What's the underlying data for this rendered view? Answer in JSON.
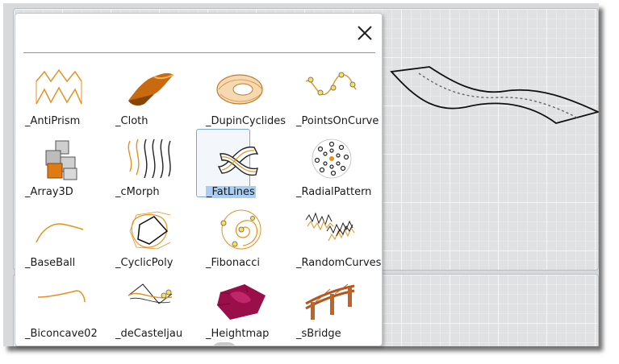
{
  "dialog": {
    "close_label": "×",
    "close_icon": "close-icon"
  },
  "items": [
    {
      "label": "_AntiPrism",
      "icon": "antiprism-icon"
    },
    {
      "label": "_Cloth",
      "icon": "cloth-icon"
    },
    {
      "label": "_DupinCyclides",
      "icon": "dupin-cyclide-icon"
    },
    {
      "label": "_PointsOnCurve",
      "icon": "points-on-curve-icon"
    },
    {
      "label": "_Array3D",
      "icon": "array3d-icon"
    },
    {
      "label": "_cMorph",
      "icon": "cmorph-icon"
    },
    {
      "label": "_FatLines",
      "icon": "fatlines-icon",
      "selected": true
    },
    {
      "label": "_RadialPattern",
      "icon": "radial-pattern-icon"
    },
    {
      "label": "_BaseBall",
      "icon": "baseball-icon"
    },
    {
      "label": "_CyclicPoly",
      "icon": "cyclic-poly-icon"
    },
    {
      "label": "_Fibonacci",
      "icon": "fibonacci-icon"
    },
    {
      "label": "_RandomCurves",
      "icon": "random-curves-icon"
    },
    {
      "label": "_Biconcave02",
      "icon": "biconcave-icon"
    },
    {
      "label": "_deCasteljau",
      "icon": "decasteljau-icon"
    },
    {
      "label": "_Heightmap",
      "icon": "heightmap-icon"
    },
    {
      "label": "_sBridge",
      "icon": "bridge-icon"
    }
  ],
  "colors": {
    "accent_orange": "#e8901f",
    "selection_fill": "#a9cdf3",
    "selection_border": "#7aa7d6",
    "viewport_bg": "#dfe1e3"
  }
}
